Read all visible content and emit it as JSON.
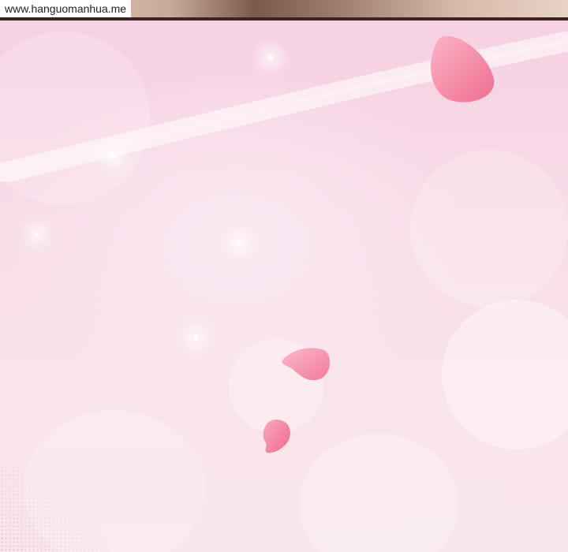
{
  "watermark": {
    "text": "www.hanguomanhua.me"
  },
  "colors": {
    "background_top": "#f6cfe2",
    "background_bottom": "#f9e6ec",
    "petal": "#f27a98",
    "petal_highlight": "#fbb3c6"
  },
  "icons": {
    "sparkle": "sparkle-glint",
    "petal": "rose-petal"
  }
}
